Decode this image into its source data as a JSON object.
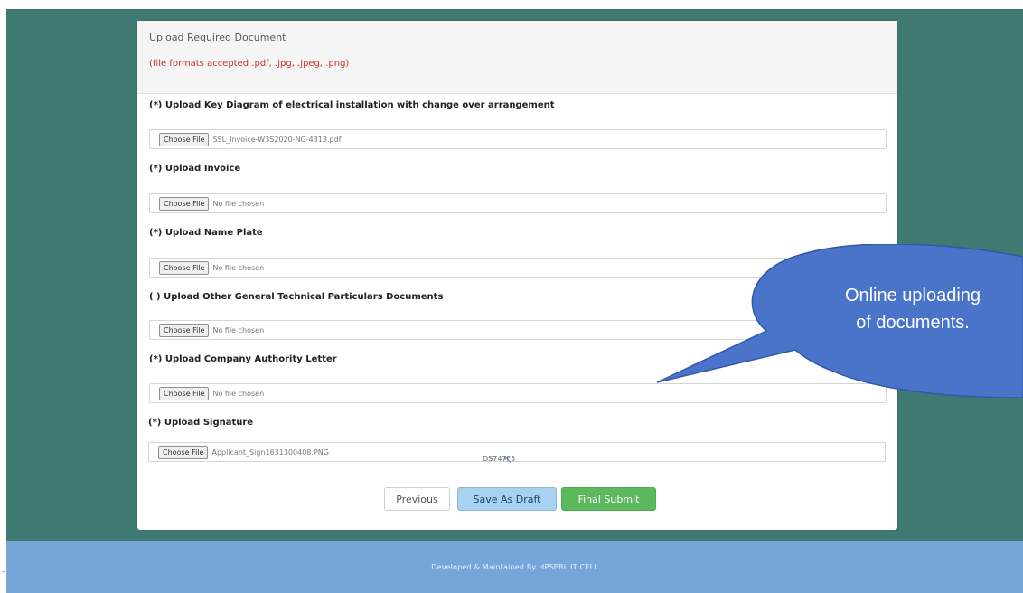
{
  "upload_section": {
    "title": "Upload Required Document",
    "formats_note": "(file formats accepted .pdf, .jpg, .jpeg, .png)"
  },
  "fields": [
    {
      "label": "(*) Upload Key Diagram of electrical installation with change over arrangement",
      "button": "Choose File",
      "file": "SSL_Invoice-W3S2020-NG-4313.pdf"
    },
    {
      "label": "(*) Upload Invoice",
      "button": "Choose File",
      "file": "No file chosen"
    },
    {
      "label": "(*) Upload Name Plate",
      "button": "Choose File",
      "file": "No file chosen"
    },
    {
      "label": "( ) Upload Other General Technical Particulars Documents",
      "button": "Choose File",
      "file": "No file chosen"
    },
    {
      "label": "(*) Upload Company Authority Letter",
      "button": "Choose File",
      "file": "No file chosen"
    },
    {
      "label": "(*) Upload Signature",
      "button": "Choose File",
      "file": "Applicant_Sign1631300408.PNG"
    }
  ],
  "captcha_code": "DS747F5",
  "actions": {
    "previous": "Previous",
    "save_draft": "Save As Draft",
    "final_submit": "Final Submit"
  },
  "footer": "Developed & Maintained By HPSEBL IT CELL",
  "callout": {
    "line1": "Online uploading",
    "line2": "of documents."
  },
  "colors": {
    "background": "#3f7a72",
    "footer": "#76a6d9",
    "callout": "#4a74c9",
    "final_submit": "#5cb85c",
    "save_draft": "#a9d1f0",
    "note": "#c9302c"
  },
  "icons": {
    "cursor": "mouse-pointer-icon"
  }
}
